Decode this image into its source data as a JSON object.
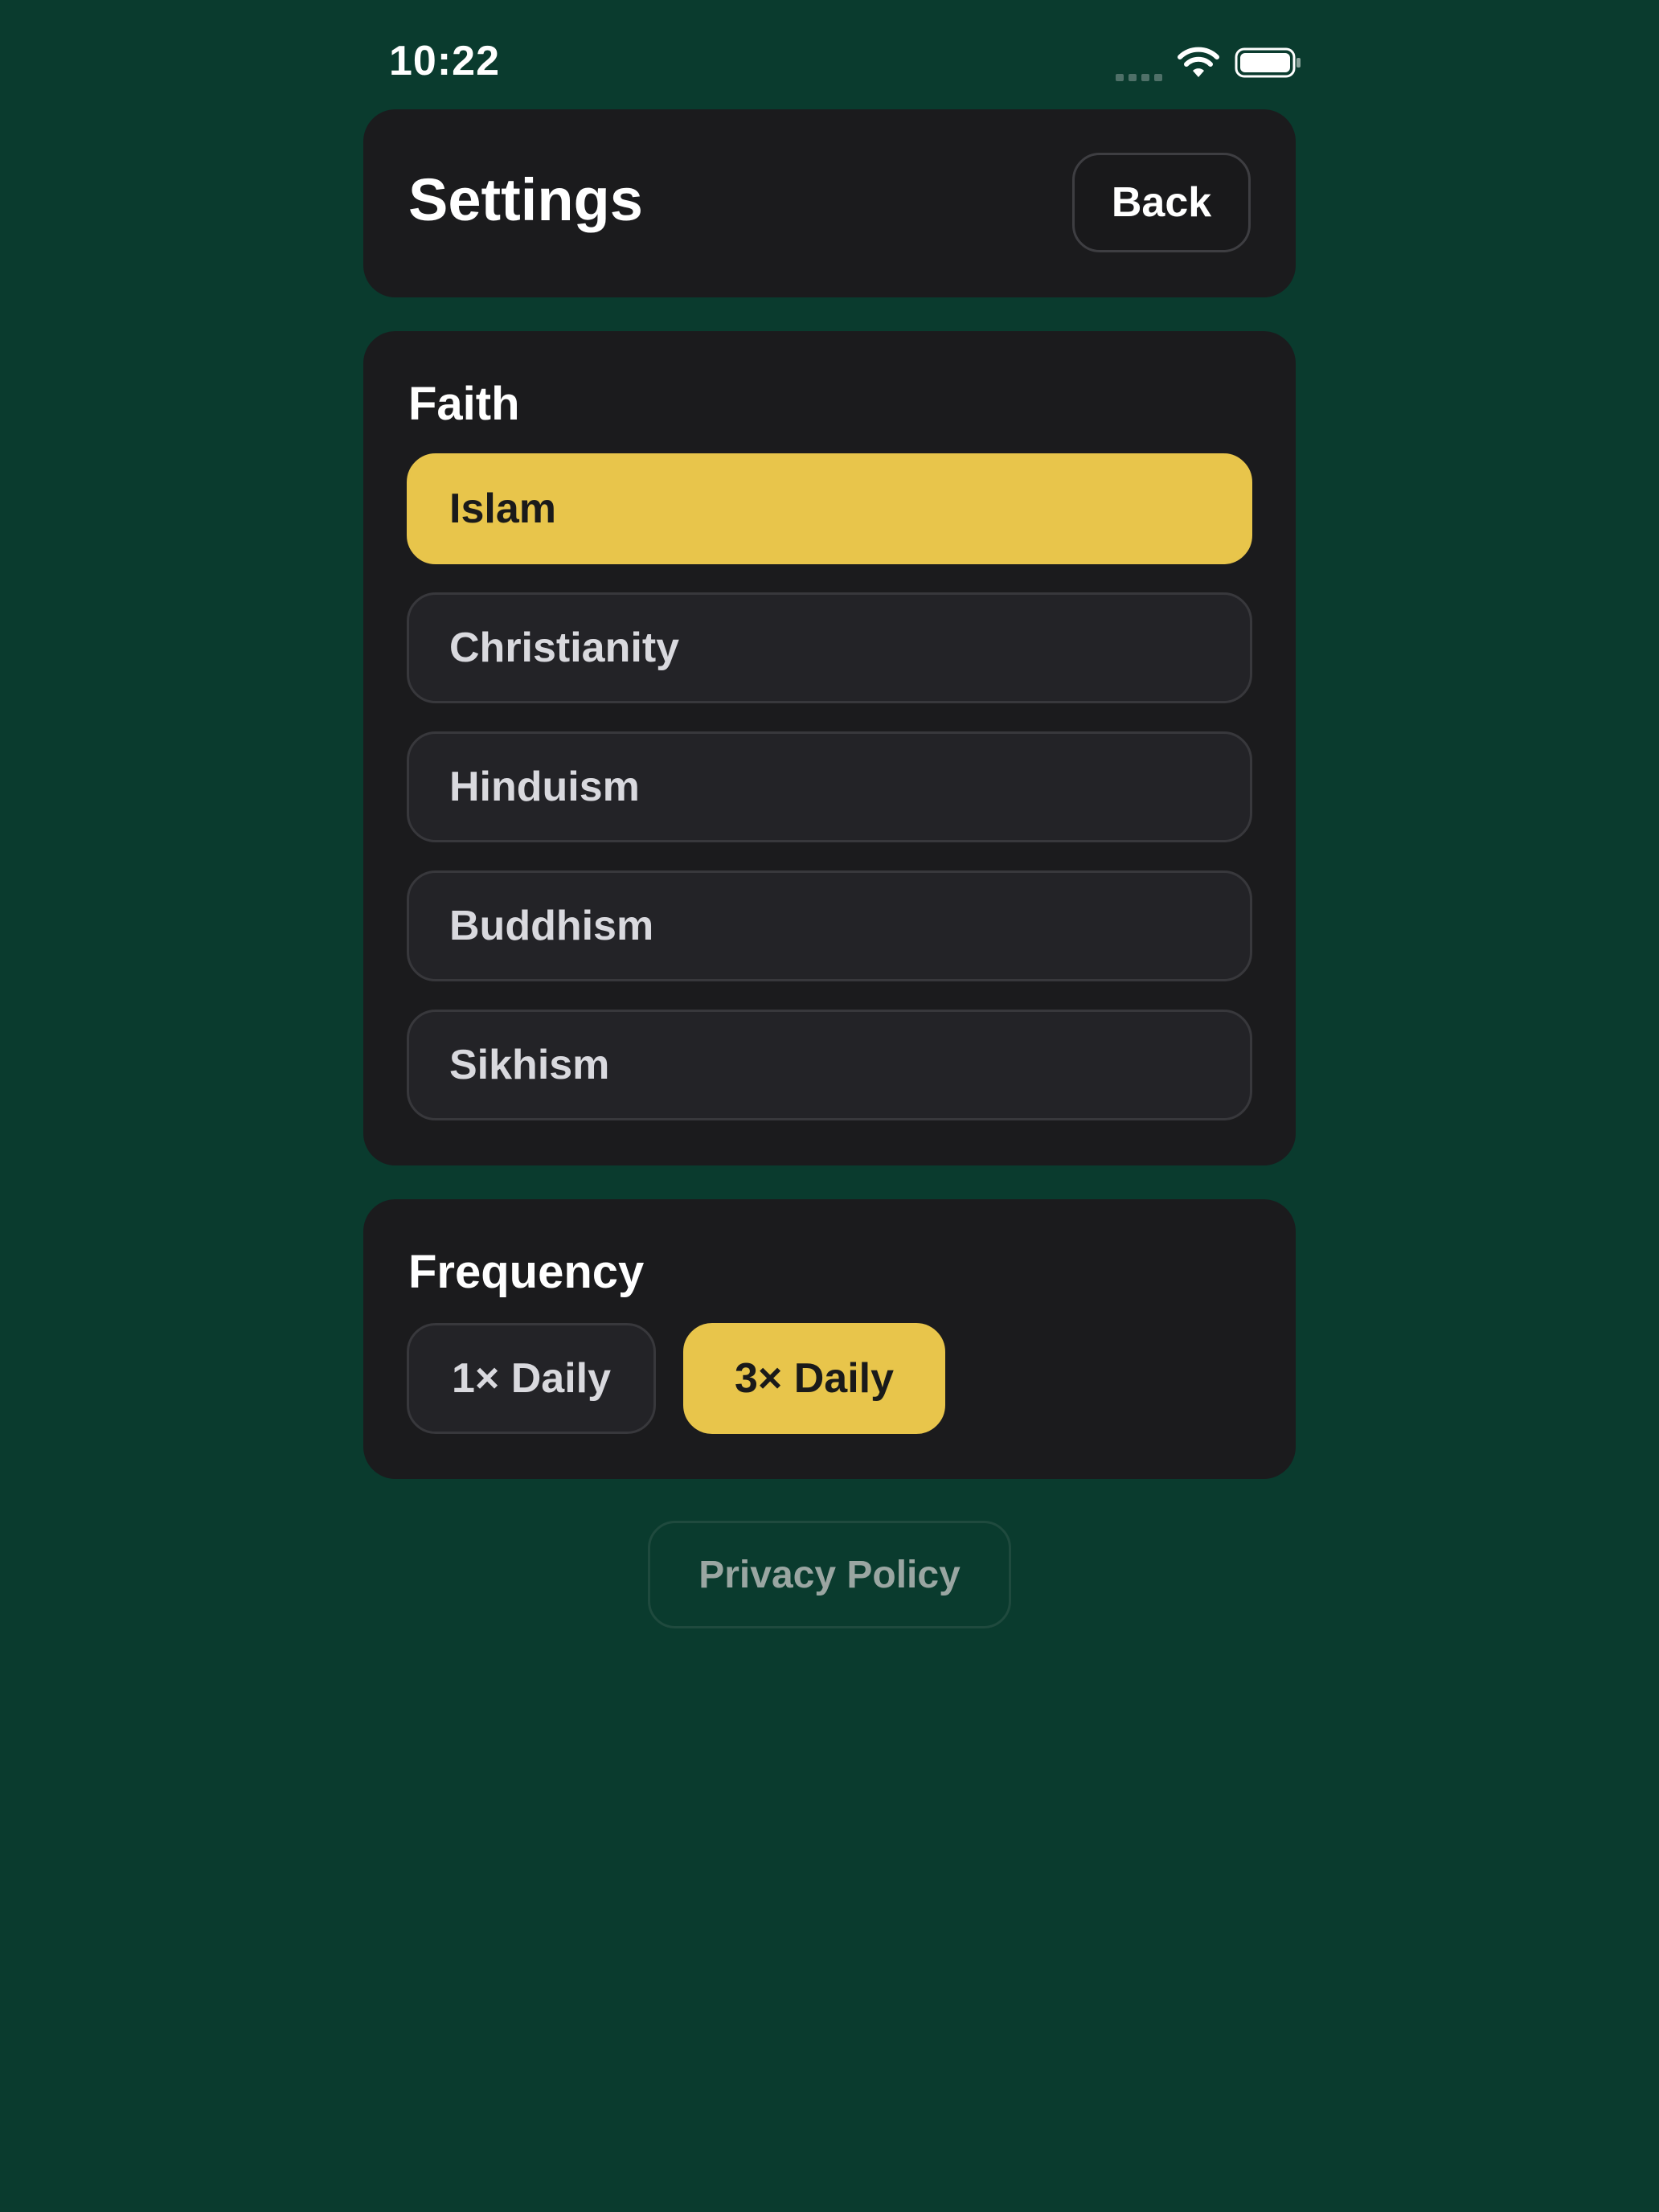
{
  "status_bar": {
    "time": "10:22",
    "icons": [
      "signal-icon",
      "wifi-icon",
      "battery-icon"
    ]
  },
  "header": {
    "title": "Settings",
    "back_label": "Back"
  },
  "faith": {
    "title": "Faith",
    "options": [
      {
        "label": "Islam",
        "selected": true
      },
      {
        "label": "Christianity",
        "selected": false
      },
      {
        "label": "Hinduism",
        "selected": false
      },
      {
        "label": "Buddhism",
        "selected": false
      },
      {
        "label": "Sikhism",
        "selected": false
      }
    ]
  },
  "frequency": {
    "title": "Frequency",
    "options": [
      {
        "label": "1× Daily",
        "selected": false
      },
      {
        "label": "3× Daily",
        "selected": true
      }
    ]
  },
  "footer": {
    "privacy_label": "Privacy Policy"
  },
  "colors": {
    "background": "#0a3b2e",
    "card": "#1b1b1d",
    "accent": "#e8c54b"
  }
}
